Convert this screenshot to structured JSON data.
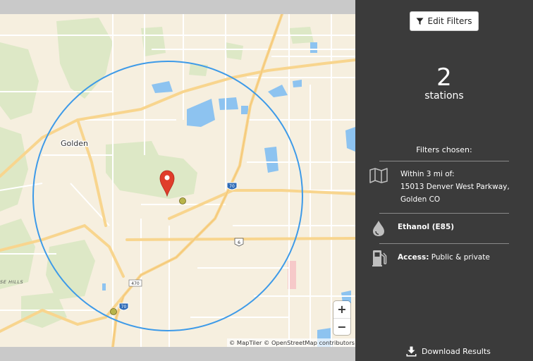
{
  "map": {
    "place_labels": {
      "golden": "Golden",
      "hills": "SE HILLS"
    },
    "shields": {
      "i70_top": "70",
      "us6": "6",
      "route470": "470",
      "i70_bottom": "70"
    },
    "zoom_in": "+",
    "zoom_out": "−",
    "attribution": {
      "maptiler": "© MapTiler",
      "osm": "© OpenStreetMap contributors"
    },
    "colors": {
      "land": "#f6efdf",
      "park": "#dde8c6",
      "water": "#8dc3f0",
      "road": "#ffffff",
      "highway": "#f8d58e",
      "radius": "#3d9ae8",
      "pin": "#e03d2b",
      "station": "#b8b44a"
    }
  },
  "panel": {
    "edit_filters": "Edit Filters",
    "station_count": "2",
    "station_label": "stations",
    "filters_title": "Filters chosen:",
    "location": {
      "prefix": "Within 3 mi of:",
      "address_line1": "15013 Denver West Parkway,",
      "address_line2": "Golden CO",
      "icon": "map-icon"
    },
    "fuel": {
      "label": "Ethanol (E85)",
      "icon": "drop-icon"
    },
    "access": {
      "label": "Access:",
      "value": "Public & private",
      "icon": "fuel-pump-icon"
    },
    "download": "Download Results",
    "colors": {
      "background": "#3b3b3b",
      "divider": "#8a8a8a",
      "text": "#ffffff"
    }
  }
}
